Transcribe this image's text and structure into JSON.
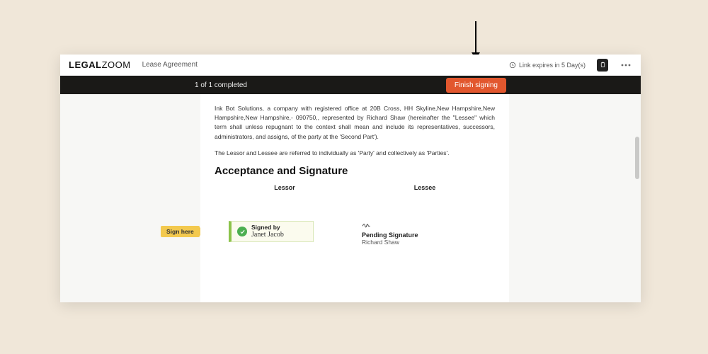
{
  "annotation": {
    "arrow_target": "finish-signing-button"
  },
  "header": {
    "logo_bold": "LEGAL",
    "logo_light": "ZOOM",
    "tab_label": "Lease Agreement",
    "expiry_text": "Link expires in 5 Day(s)",
    "clipboard_icon": "clipboard-icon",
    "more_icon": "more-icon"
  },
  "progress": {
    "status_text": "1 of 1 completed",
    "finish_label": "Finish signing"
  },
  "document": {
    "para1": "Ink Bot Solutions, a company with registered office at 20B Cross, HH Skyline,New Hampshire,New Hampshire,New Hampshire,- 090750,, represented by Richard Shaw (hereinafter the \"Lessee\" which term shall unless repugnant to the context shall mean and include its representatives, successors, administrators, and assigns, of the party at the 'Second Part').",
    "para2": "The Lessor and Lessee are referred to individually as 'Party' and collectively as 'Parties'.",
    "heading": "Acceptance and Signature",
    "lessor_label": "Lessor",
    "lessee_label": "Lessee",
    "signed_by_label": "Signed by",
    "signed_name": "Janet Jacob",
    "pending_label": "Pending Signature",
    "pending_name": "Richard Shaw"
  },
  "badges": {
    "sign_here": "Sign here"
  }
}
